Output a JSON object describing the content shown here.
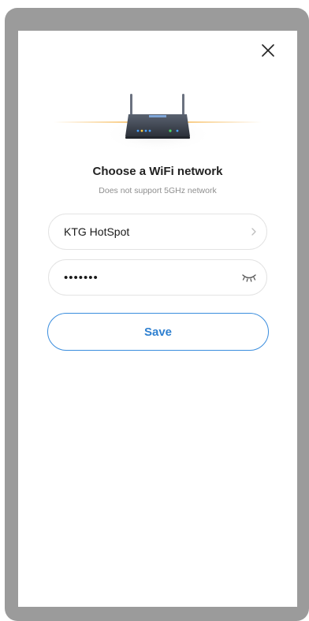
{
  "dialog": {
    "close_icon": "close-icon",
    "illustration": "wifi-router-icon",
    "title": "Choose a WiFi network",
    "subtitle": "Does not support 5GHz network"
  },
  "form": {
    "ssid_value": "KTG HotSpot",
    "ssid_icon": "chevron-right-icon",
    "password_value": "•••••••",
    "password_icon": "eye-closed-icon",
    "save_label": "Save"
  },
  "colors": {
    "accent": "#3a8dde",
    "frame": "#9b9b9b",
    "glow": "#f5b041"
  }
}
